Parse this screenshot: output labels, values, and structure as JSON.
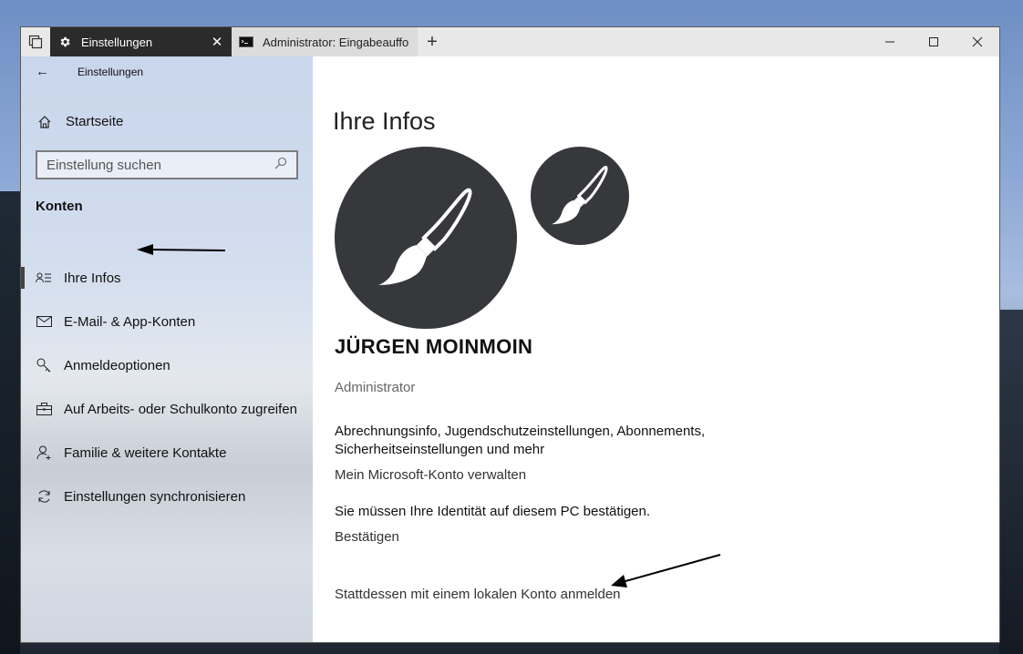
{
  "titlebar": {
    "tabs": [
      {
        "label": "Einstellungen",
        "icon": "gear-icon",
        "active": true
      },
      {
        "label": "Administrator: Eingabeauffo",
        "icon": "console-icon",
        "active": false
      }
    ],
    "new_tab_glyph": "+",
    "close_glyph": "✕"
  },
  "sidebar": {
    "back_glyph": "←",
    "app_title": "Einstellungen",
    "home_label": "Startseite",
    "search_placeholder": "Einstellung suchen",
    "section_label": "Konten",
    "items": [
      {
        "label": "Ihre Infos",
        "icon": "contact-card-icon",
        "selected": true
      },
      {
        "label": "E-Mail- & App-Konten",
        "icon": "mail-icon"
      },
      {
        "label": "Anmeldeoptionen",
        "icon": "key-icon"
      },
      {
        "label": "Auf Arbeits- oder Schulkonto zugreifen",
        "icon": "briefcase-icon"
      },
      {
        "label": "Familie & weitere Kontakte",
        "icon": "person-add-icon"
      },
      {
        "label": "Einstellungen synchronisieren",
        "icon": "sync-icon"
      }
    ]
  },
  "main": {
    "title": "Ihre Infos",
    "user_name": "JÜRGEN MOINMOIN",
    "user_role": "Administrator",
    "info_text": "Abrechnungsinfo, Jugendschutzeinstellungen, Abonnements, Sicherheitseinstellungen und mehr",
    "manage_link": "Mein Microsoft-Konto verwalten",
    "verify_text": "Sie müssen Ihre Identität auf diesem PC bestätigen.",
    "verify_link": "Bestätigen",
    "local_account_link": "Stattdessen mit einem lokalen Konto anmelden"
  },
  "colors": {
    "active_tab": "#2b2b2b",
    "avatar_bg": "#37383c",
    "window_bg": "#ffffff"
  }
}
